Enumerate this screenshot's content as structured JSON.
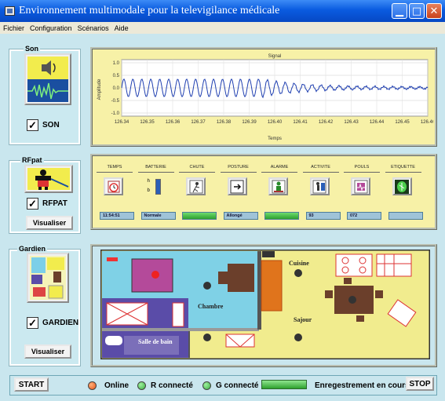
{
  "window": {
    "title": "Environnement multimodale pour la televigilance médicale"
  },
  "menu": [
    "Fichier",
    "Configuration",
    "Scénarios",
    "Aide"
  ],
  "son": {
    "title": "Son",
    "checkbox_label": "SON",
    "checked_mark": "✓"
  },
  "signal": {
    "title": "Signal",
    "xlabel": "Temps",
    "ylabel": "Amplitude",
    "yticks": [
      "1.0",
      "0.5",
      "0.0",
      "-0.5",
      "-1.0"
    ],
    "xticks": [
      "126.34",
      "126.35",
      "126.36",
      "126.37",
      "126.38",
      "126.39",
      "126.40",
      "126.41",
      "126.42",
      "126.43",
      "126.44",
      "126.45",
      "126.46"
    ]
  },
  "rfpat": {
    "title": "RFpat",
    "checkbox_label": "RFPAT",
    "visualiser_label": "Visualiser"
  },
  "sensors": {
    "columns": [
      "TEMPS",
      "BATTERIE",
      "CHUTE",
      "POSTURE",
      "ALARME",
      "ACTIVITE",
      "POULS",
      "ETIQUETTE"
    ],
    "battery_high": "h",
    "battery_low": "b",
    "values": [
      "11:54:51",
      "Normale",
      "",
      "Allongé",
      "",
      "93",
      "072",
      ""
    ]
  },
  "gardien": {
    "title": "Gardien",
    "checkbox_label": "GARDIEN",
    "visualiser_label": "Visualiser"
  },
  "floorplan": {
    "rooms": [
      "Cuisine",
      "Chambre",
      "Sajour",
      "Salle de bain"
    ]
  },
  "bottom": {
    "start_label": "START",
    "online_label": "Online",
    "r_label": "R connecté",
    "g_label": "G connecté",
    "recording_label": "Enregestrement en cours",
    "stop_label": "STOP"
  },
  "colors": {
    "accent_green": "#2ea12e",
    "led_orange": "#e8561a",
    "led_green": "#3cb043"
  }
}
